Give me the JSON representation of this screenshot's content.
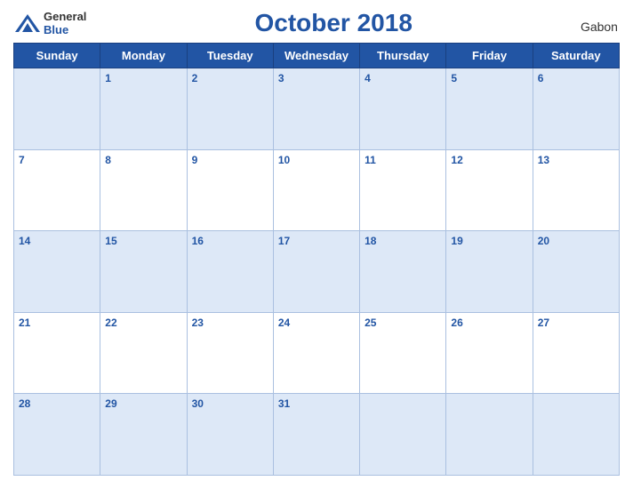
{
  "header": {
    "logo_general": "General",
    "logo_blue": "Blue",
    "title": "October 2018",
    "country": "Gabon"
  },
  "days_of_week": [
    "Sunday",
    "Monday",
    "Tuesday",
    "Wednesday",
    "Thursday",
    "Friday",
    "Saturday"
  ],
  "weeks": [
    [
      null,
      1,
      2,
      3,
      4,
      5,
      6
    ],
    [
      7,
      8,
      9,
      10,
      11,
      12,
      13
    ],
    [
      14,
      15,
      16,
      17,
      18,
      19,
      20
    ],
    [
      21,
      22,
      23,
      24,
      25,
      26,
      27
    ],
    [
      28,
      29,
      30,
      31,
      null,
      null,
      null
    ]
  ]
}
